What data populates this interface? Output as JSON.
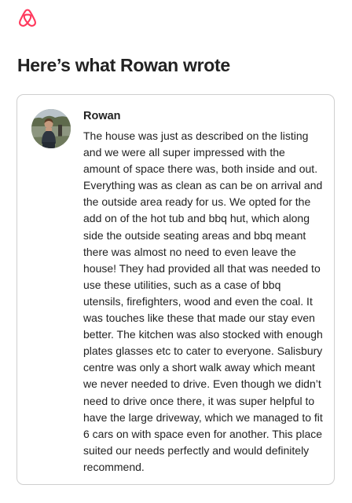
{
  "brand": {
    "logo_icon": "airbnb-logo-icon",
    "color": "#FF385C"
  },
  "page": {
    "heading": "Here’s what Rowan wrote"
  },
  "review": {
    "avatar_icon": "avatar",
    "name": "Rowan",
    "text": "The house was just as described on the listing and we were all super impressed with the amount of space there was, both inside and out. Everything was as clean as can be on arrival and the outside area ready for us. We opted for the add on of the hot tub and bbq hut, which along side the outside seating areas and bbq meant there was almost no need to even leave the house! They had provided all that was needed to use these utilities, such as a case of bbq utensils, firefighters, wood and even the coal. It was touches like these that made our stay even better. The kitchen was also stocked with enough plates glasses etc to cater to everyone. Salisbury centre was only a short walk away which meant we never needed to drive. Even though we didn’t need to drive once there, it was super helpful to have the large driveway, which we managed to fit 6 cars on with space even for another. This place suited our needs perfectly and would definitely recommend."
  }
}
